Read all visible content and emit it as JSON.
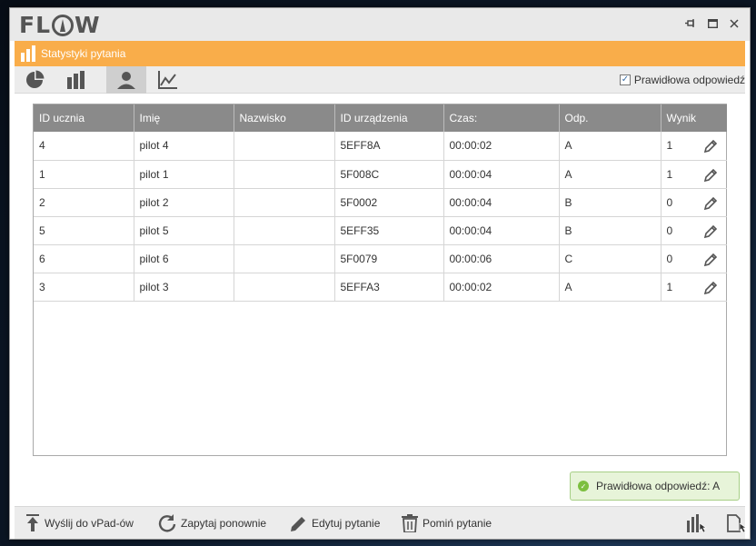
{
  "app": {
    "logo_left": "FL",
    "logo_right": "W"
  },
  "header": {
    "title": "Statystyki pytania"
  },
  "tabs": [
    {
      "icon": "pie-chart-icon"
    },
    {
      "icon": "bar-chart-icon"
    },
    {
      "icon": "user-icon"
    },
    {
      "icon": "line-chart-icon"
    }
  ],
  "active_tab": 2,
  "correct_answer_toggle": {
    "label": "Prawidłowa odpowiedź",
    "checked": true,
    "mark": "✓"
  },
  "table": {
    "columns": [
      "ID ucznia",
      "Imię",
      "Nazwisko",
      "ID urządzenia",
      "Czas:",
      "Odp.",
      "Wynik"
    ],
    "rows": [
      [
        "4",
        "pilot 4",
        "",
        "5EFF8A",
        "00:00:02",
        "A",
        "1"
      ],
      [
        "1",
        "pilot 1",
        "",
        "5F008C",
        "00:00:04",
        "A",
        "1"
      ],
      [
        "2",
        "pilot 2",
        "",
        "5F0002",
        "00:00:04",
        "B",
        "0"
      ],
      [
        "5",
        "pilot 5",
        "",
        "5EFF35",
        "00:00:04",
        "B",
        "0"
      ],
      [
        "6",
        "pilot 6",
        "",
        "5F0079",
        "00:00:06",
        "C",
        "0"
      ],
      [
        "3",
        "pilot 3",
        "",
        "5EFFA3",
        "00:00:02",
        "A",
        "1"
      ]
    ]
  },
  "toast": {
    "text": "Prawidłowa odpowiedź: A"
  },
  "footer": {
    "send": "Wyślij do vPad-ów",
    "ask_again": "Zapytaj ponownie",
    "edit": "Edytuj pytanie",
    "skip": "Pomiń pytanie"
  },
  "colors": {
    "accent_orange": "#f9ad4a",
    "header_gray": "#8a8a8a",
    "success_green": "#7cbf3f"
  }
}
